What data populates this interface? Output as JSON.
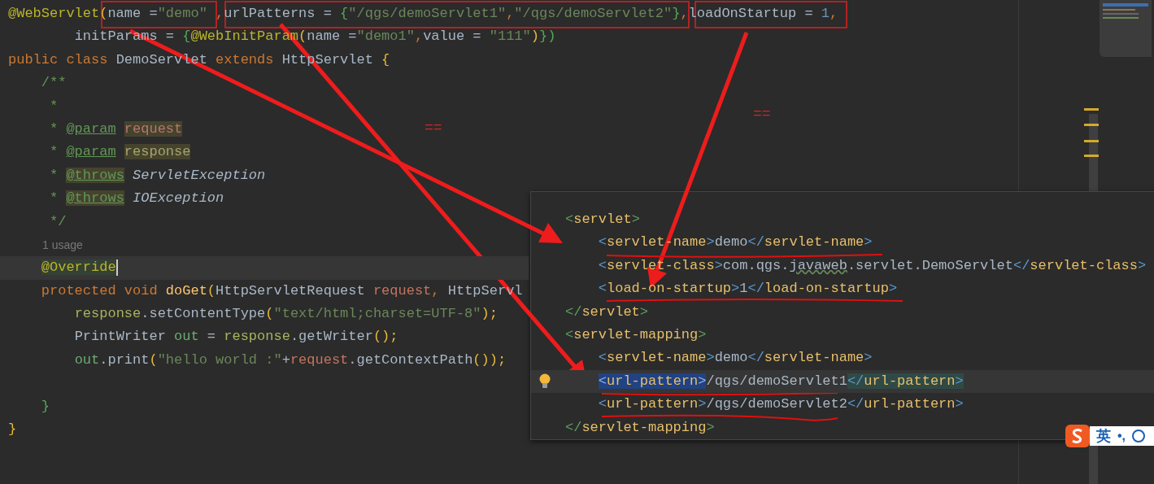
{
  "code_lines": [
    {
      "current": false,
      "tokens": [
        {
          "t": "@WebServlet",
          "kind": "annotation"
        },
        {
          "t": "(",
          "kind": "brace-y"
        },
        {
          "t": "name =",
          "kind": "plain"
        },
        {
          "t": "\"demo\"",
          "kind": "string"
        },
        {
          "t": " ,",
          "kind": "keyword"
        },
        {
          "t": "urlPatterns = ",
          "kind": "plain"
        },
        {
          "t": "{",
          "kind": "brace-g"
        },
        {
          "t": "\"/qgs/demoServlet1\"",
          "kind": "string"
        },
        {
          "t": ",",
          "kind": "keyword"
        },
        {
          "t": "\"/qgs/demoServlet2\"",
          "kind": "string"
        },
        {
          "t": "}",
          "kind": "brace-g"
        },
        {
          "t": ",",
          "kind": "keyword"
        },
        {
          "t": "loadOnStartup = ",
          "kind": "plain"
        },
        {
          "t": "1",
          "kind": "number"
        },
        {
          "t": ",",
          "kind": "keyword"
        }
      ]
    },
    {
      "current": false,
      "tokens": [
        {
          "t": "        initParams = ",
          "kind": "plain"
        },
        {
          "t": "{",
          "kind": "brace-g"
        },
        {
          "t": "@WebInitParam",
          "kind": "annotation"
        },
        {
          "t": "(",
          "kind": "brace-y"
        },
        {
          "t": "name =",
          "kind": "plain"
        },
        {
          "t": "\"demo1\"",
          "kind": "string"
        },
        {
          "t": ",",
          "kind": "keyword"
        },
        {
          "t": "value = ",
          "kind": "plain"
        },
        {
          "t": "\"111\"",
          "kind": "string"
        },
        {
          "t": ")",
          "kind": "brace-y"
        },
        {
          "t": "})",
          "kind": "brace-g"
        }
      ]
    },
    {
      "current": false,
      "tokens": [
        {
          "t": "public class ",
          "kind": "keyword"
        },
        {
          "t": "DemoServlet ",
          "kind": "plain"
        },
        {
          "t": "extends ",
          "kind": "keyword"
        },
        {
          "t": "HttpServlet ",
          "kind": "plain"
        },
        {
          "t": "{",
          "kind": "brace-y"
        }
      ]
    },
    {
      "current": false,
      "tokens": [
        {
          "t": "    /**",
          "kind": "comment"
        }
      ]
    },
    {
      "current": false,
      "tokens": [
        {
          "t": "     *",
          "kind": "comment"
        }
      ]
    },
    {
      "current": false,
      "tokens": [
        {
          "t": "     *",
          "kind": "comment"
        },
        {
          "t": " @param",
          "kind": "doctag"
        },
        {
          "t": " request",
          "kind": "docparam"
        }
      ]
    },
    {
      "current": false,
      "tokens": [
        {
          "t": "     *",
          "kind": "comment"
        },
        {
          "t": " @param",
          "kind": "doctag"
        },
        {
          "t": " response",
          "kind": "docparam2"
        }
      ]
    },
    {
      "current": false,
      "tokens": [
        {
          "t": "     *",
          "kind": "comment"
        },
        {
          "t": " @throws",
          "kind": "doctag-bg"
        },
        {
          "t": " ServletException",
          "kind": "docitalic"
        }
      ]
    },
    {
      "current": false,
      "tokens": [
        {
          "t": "     *",
          "kind": "comment"
        },
        {
          "t": " @throws",
          "kind": "doctag-bg"
        },
        {
          "t": " IOException",
          "kind": "docitalic"
        }
      ]
    },
    {
      "current": false,
      "tokens": [
        {
          "t": "     */",
          "kind": "comment"
        }
      ]
    },
    {
      "current": false,
      "hint": "1 usage"
    },
    {
      "current": true,
      "tokens": [
        {
          "t": "    @Override",
          "kind": "annotation-bg"
        }
      ]
    },
    {
      "current": false,
      "tokens": [
        {
          "t": "    protected void ",
          "kind": "keyword"
        },
        {
          "t": "doGet",
          "kind": "method"
        },
        {
          "t": "(",
          "kind": "brace-y"
        },
        {
          "t": "HttpServletRequest ",
          "kind": "plain"
        },
        {
          "t": "request",
          "kind": "param"
        },
        {
          "t": ", ",
          "kind": "keyword"
        },
        {
          "t": "HttpServl",
          "kind": "plain"
        }
      ]
    },
    {
      "current": false,
      "tokens": [
        {
          "t": "        response",
          "kind": "local"
        },
        {
          "t": ".setContentType",
          "kind": "plain"
        },
        {
          "t": "(",
          "kind": "brace-y"
        },
        {
          "t": "\"text/html;charset=UTF-8\"",
          "kind": "string"
        },
        {
          "t": ");",
          "kind": "brace-y"
        }
      ]
    },
    {
      "current": false,
      "tokens": [
        {
          "t": "        PrintWriter ",
          "kind": "plain"
        },
        {
          "t": "out",
          "kind": "var"
        },
        {
          "t": " = ",
          "kind": "plain"
        },
        {
          "t": "response",
          "kind": "local"
        },
        {
          "t": ".getWriter",
          "kind": "plain"
        },
        {
          "t": "();",
          "kind": "brace-y"
        }
      ]
    },
    {
      "current": false,
      "tokens": [
        {
          "t": "        out",
          "kind": "var"
        },
        {
          "t": ".print",
          "kind": "plain"
        },
        {
          "t": "(",
          "kind": "brace-y"
        },
        {
          "t": "\"hello world :\"",
          "kind": "string"
        },
        {
          "t": "+",
          "kind": "plain"
        },
        {
          "t": "request",
          "kind": "param"
        },
        {
          "t": ".getContextPath",
          "kind": "plain"
        },
        {
          "t": "());",
          "kind": "brace-y"
        }
      ]
    },
    {
      "current": false
    },
    {
      "current": false,
      "tokens": [
        {
          "t": "    }",
          "kind": "brace-g"
        }
      ]
    },
    {
      "current": false,
      "tokens": [
        {
          "t": "}",
          "kind": "brace-y"
        }
      ]
    }
  ],
  "xml_popup": {
    "lines": [
      {
        "current": false,
        "tokens": [
          {
            "t": "<",
            "kind": "xbr-outer"
          },
          {
            "t": "servlet",
            "kind": "xtag"
          },
          {
            "t": ">",
            "kind": "xbr-outer"
          }
        ]
      },
      {
        "current": false,
        "tokens": [
          {
            "t": "    <",
            "kind": "xbr"
          },
          {
            "t": "servlet-name",
            "kind": "xtag"
          },
          {
            "t": ">",
            "kind": "xbr"
          },
          {
            "t": "demo",
            "kind": "xtext"
          },
          {
            "t": "</",
            "kind": "xbr"
          },
          {
            "t": "servlet-name",
            "kind": "xtag"
          },
          {
            "t": ">",
            "kind": "xbr"
          }
        ]
      },
      {
        "current": false,
        "tokens": [
          {
            "t": "    <",
            "kind": "xbr"
          },
          {
            "t": "servlet-class",
            "kind": "xtag"
          },
          {
            "t": ">",
            "kind": "xbr"
          },
          {
            "t": "com.qgs.",
            "kind": "xtext"
          },
          {
            "t": "javaweb",
            "kind": "xtypo"
          },
          {
            "t": ".servlet.DemoServlet",
            "kind": "xtext"
          },
          {
            "t": "</",
            "kind": "xbr"
          },
          {
            "t": "servlet-class",
            "kind": "xtag"
          },
          {
            "t": ">",
            "kind": "xbr"
          }
        ]
      },
      {
        "current": false,
        "tokens": [
          {
            "t": "    <",
            "kind": "xbr"
          },
          {
            "t": "load-on-startup",
            "kind": "xtag"
          },
          {
            "t": ">",
            "kind": "xbr"
          },
          {
            "t": "1",
            "kind": "xtext"
          },
          {
            "t": "</",
            "kind": "xbr"
          },
          {
            "t": "load-on-startup",
            "kind": "xtag"
          },
          {
            "t": ">",
            "kind": "xbr"
          }
        ]
      },
      {
        "current": false,
        "tokens": [
          {
            "t": "</",
            "kind": "xbr-outer"
          },
          {
            "t": "servlet",
            "kind": "xtag"
          },
          {
            "t": ">",
            "kind": "xbr-outer"
          }
        ]
      },
      {
        "current": false,
        "tokens": [
          {
            "t": "<",
            "kind": "xbr-outer"
          },
          {
            "t": "servlet-mapping",
            "kind": "xtag"
          },
          {
            "t": ">",
            "kind": "xbr-outer"
          }
        ]
      },
      {
        "current": false,
        "tokens": [
          {
            "t": "    <",
            "kind": "xbr"
          },
          {
            "t": "servlet-name",
            "kind": "xtag"
          },
          {
            "t": ">",
            "kind": "xbr"
          },
          {
            "t": "demo",
            "kind": "xtext"
          },
          {
            "t": "</",
            "kind": "xbr"
          },
          {
            "t": "servlet-name",
            "kind": "xtag"
          },
          {
            "t": ">",
            "kind": "xbr"
          }
        ]
      },
      {
        "current": true,
        "bulb": true,
        "tokens": [
          {
            "t": "    <",
            "kind": "xbr-sel"
          },
          {
            "t": "url-pattern",
            "kind": "xtag-sel"
          },
          {
            "t": ">",
            "kind": "xbr-sel"
          },
          {
            "t": "/qgs/demoServlet1",
            "kind": "xtext"
          },
          {
            "t": "</",
            "kind": "xbr-match"
          },
          {
            "t": "url-pattern",
            "kind": "xtag-match"
          },
          {
            "t": ">",
            "kind": "xbr-match"
          }
        ]
      },
      {
        "current": false,
        "tokens": [
          {
            "t": "    <",
            "kind": "xbr"
          },
          {
            "t": "url-pattern",
            "kind": "xtag"
          },
          {
            "t": ">",
            "kind": "xbr"
          },
          {
            "t": "/qgs/demoServlet2",
            "kind": "xtext"
          },
          {
            "t": "</",
            "kind": "xbr"
          },
          {
            "t": "url-pattern",
            "kind": "xtag"
          },
          {
            "t": ">",
            "kind": "xbr"
          }
        ]
      },
      {
        "current": false,
        "tokens": [
          {
            "t": "</",
            "kind": "xbr-outer"
          },
          {
            "t": "servlet-mapping",
            "kind": "xtag"
          },
          {
            "t": ">",
            "kind": "xbr-outer"
          }
        ]
      }
    ]
  },
  "annotation_marks": [
    "==",
    "=="
  ],
  "ime_toolbar": {
    "mode": "英",
    "punctuation": "•,"
  }
}
